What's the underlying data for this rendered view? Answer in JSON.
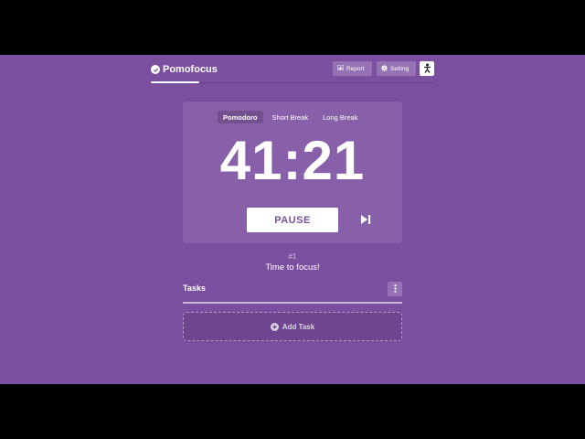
{
  "app": {
    "name": "Pomofocus"
  },
  "header": {
    "report_label": "Report",
    "setting_label": "Setting",
    "progress_fraction": 0.17
  },
  "modes": [
    {
      "label": "Pomodoro",
      "active": true
    },
    {
      "label": "Short Break",
      "active": false
    },
    {
      "label": "Long Break",
      "active": false
    }
  ],
  "timer": {
    "display": "41:21"
  },
  "controls": {
    "pause_label": "PAUSE"
  },
  "session": {
    "round": "#1",
    "message": "Time to focus!"
  },
  "tasks": {
    "title": "Tasks",
    "add_label": "Add Task"
  },
  "colors": {
    "background": "#7b4fa0",
    "accent": "#ffffff"
  },
  "icons": {
    "brand": "check-circle-icon",
    "report": "bar-chart-icon",
    "setting": "gear-icon",
    "user": "user-icon",
    "skip": "skip-next-icon",
    "menu": "vertical-dots-icon",
    "add": "plus-circle-icon"
  }
}
